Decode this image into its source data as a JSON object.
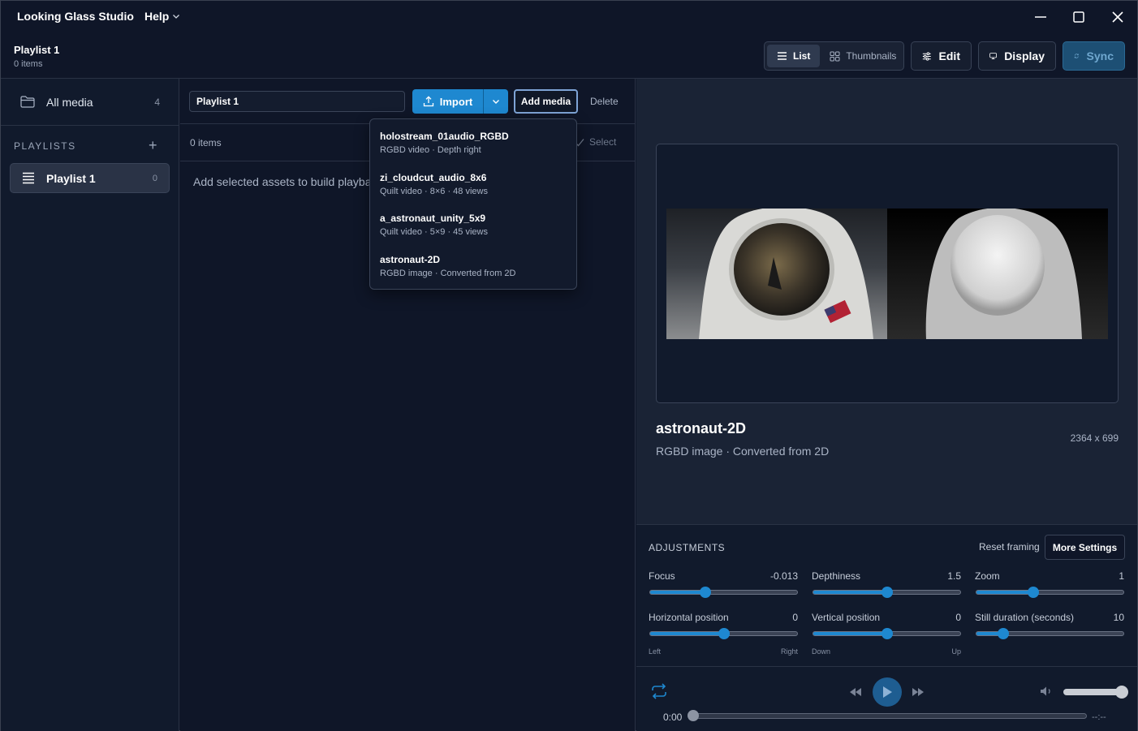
{
  "app": {
    "name": "Looking Glass Studio",
    "help_menu": "Help"
  },
  "header": {
    "playlist_title": "Playlist 1",
    "playlist_count": "0 items",
    "view_list": "List",
    "view_thumbnails": "Thumbnails",
    "edit": "Edit",
    "display": "Display",
    "sync": "Sync"
  },
  "sidebar": {
    "all_media": {
      "label": "All media",
      "count": "4"
    },
    "playlists_heading": "PLAYLISTS",
    "add_symbol": "+",
    "playlists": [
      {
        "label": "Playlist 1",
        "count": "0"
      }
    ]
  },
  "editor": {
    "name_value": "Playlist 1",
    "import": "Import",
    "add_media": "Add media",
    "delete": "Delete",
    "items_count": "0 items",
    "select": "Select",
    "empty_message": "Add selected assets to build playba"
  },
  "add_media_menu": [
    {
      "name": "holostream_01audio_RGBD",
      "detail": "RGBD video · Depth right"
    },
    {
      "name": "zi_cloudcut_audio_8x6",
      "detail": "Quilt video · 8×6 · 48 views"
    },
    {
      "name": "a_astronaut_unity_5x9",
      "detail": "Quilt video · 5×9 · 45 views"
    },
    {
      "name": "astronaut-2D",
      "detail": "RGBD image · Converted from 2D"
    }
  ],
  "media": {
    "title": "astronaut-2D",
    "subtitle": "RGBD image · Converted from 2D",
    "dimensions": "2364 x 699"
  },
  "adjustments": {
    "title": "ADJUSTMENTS",
    "reset": "Reset framing",
    "more": "More Settings",
    "sliders": [
      {
        "label": "Focus",
        "value": "-0.013",
        "fraction": 0.375
      },
      {
        "label": "Depthiness",
        "value": "1.5",
        "fraction": 0.5
      },
      {
        "label": "Zoom",
        "value": "1",
        "fraction": 0.385
      },
      {
        "label": "Horizontal position",
        "value": "0",
        "fraction": 0.5,
        "low": "Left",
        "high": "Right"
      },
      {
        "label": "Vertical position",
        "value": "0",
        "fraction": 0.5,
        "low": "Down",
        "high": "Up"
      },
      {
        "label": "Still duration (seconds)",
        "value": "10",
        "fraction": 0.185
      }
    ]
  },
  "player": {
    "time_current": "0:00",
    "time_total": "--:--",
    "volume": 1.0,
    "progress": 0.0
  },
  "colors": {
    "accent": "#1e88d0",
    "background": "#0f1628",
    "panel": "#1a2335"
  }
}
